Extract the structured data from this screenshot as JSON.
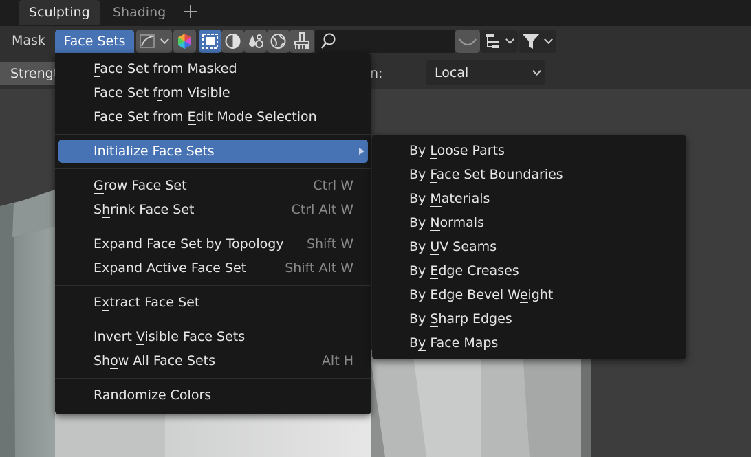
{
  "tabs": [
    {
      "label": "Sculpting",
      "active": true
    },
    {
      "label": "Shading",
      "active": false
    }
  ],
  "add_tab_icon": "plus-icon",
  "header": {
    "mask_label": "Mask",
    "face_sets_label": "Face Sets",
    "icons": [
      "curve-icon",
      "color-attribute-icon",
      "selection-mode-icon",
      "viewport-shading-icon",
      "overlay-icon",
      "world-icon",
      "paint-brush-icon",
      "search-icon",
      "proportional-falloff-icon",
      "hierarchy-icon",
      "filter-icon"
    ]
  },
  "tool_settings": {
    "strength_label": "Strengt",
    "orientation_label": "n:",
    "orientation_value": "Local"
  },
  "face_sets_menu": {
    "groups": [
      [
        {
          "label": "Face Set from Masked",
          "ul": 0,
          "shortcut": ""
        },
        {
          "label": "Face Set from Visible",
          "ul": 10,
          "shortcut": ""
        },
        {
          "label": "Face Set from Edit Mode Selection",
          "ul": 14,
          "shortcut": ""
        }
      ],
      [
        {
          "label": "Initialize Face Sets",
          "ul": 0,
          "shortcut": "",
          "submenu": true,
          "highlighted": true
        }
      ],
      [
        {
          "label": "Grow Face Set",
          "ul": 0,
          "shortcut": "Ctrl W"
        },
        {
          "label": "Shrink Face Set",
          "ul": 1,
          "shortcut": "Ctrl Alt W"
        }
      ],
      [
        {
          "label": "Expand Face Set by Topology",
          "ul": 23,
          "shortcut": "Shift W"
        },
        {
          "label": "Expand Active Face Set",
          "ul": 7,
          "shortcut": "Shift Alt W"
        }
      ],
      [
        {
          "label": "Extract Face Set",
          "ul": 1,
          "shortcut": ""
        }
      ],
      [
        {
          "label": "Invert Visible Face Sets",
          "ul": 7,
          "shortcut": ""
        },
        {
          "label": "Show All Face Sets",
          "ul": 2,
          "shortcut": "Alt H"
        }
      ],
      [
        {
          "label": "Randomize Colors",
          "ul": 0,
          "shortcut": ""
        }
      ]
    ]
  },
  "initialize_submenu": {
    "items": [
      {
        "label": "By Loose Parts",
        "ul": 3
      },
      {
        "label": "By Face Set Boundaries",
        "ul": 3
      },
      {
        "label": "By Materials",
        "ul": 3
      },
      {
        "label": "By Normals",
        "ul": 3
      },
      {
        "label": "By UV Seams",
        "ul": 3
      },
      {
        "label": "By Edge Creases",
        "ul": 3
      },
      {
        "label": "By Edge Bevel Weight",
        "ul": 15
      },
      {
        "label": "By Sharp Edges",
        "ul": 3
      },
      {
        "label": "By Face Maps",
        "ul": 1
      }
    ]
  }
}
